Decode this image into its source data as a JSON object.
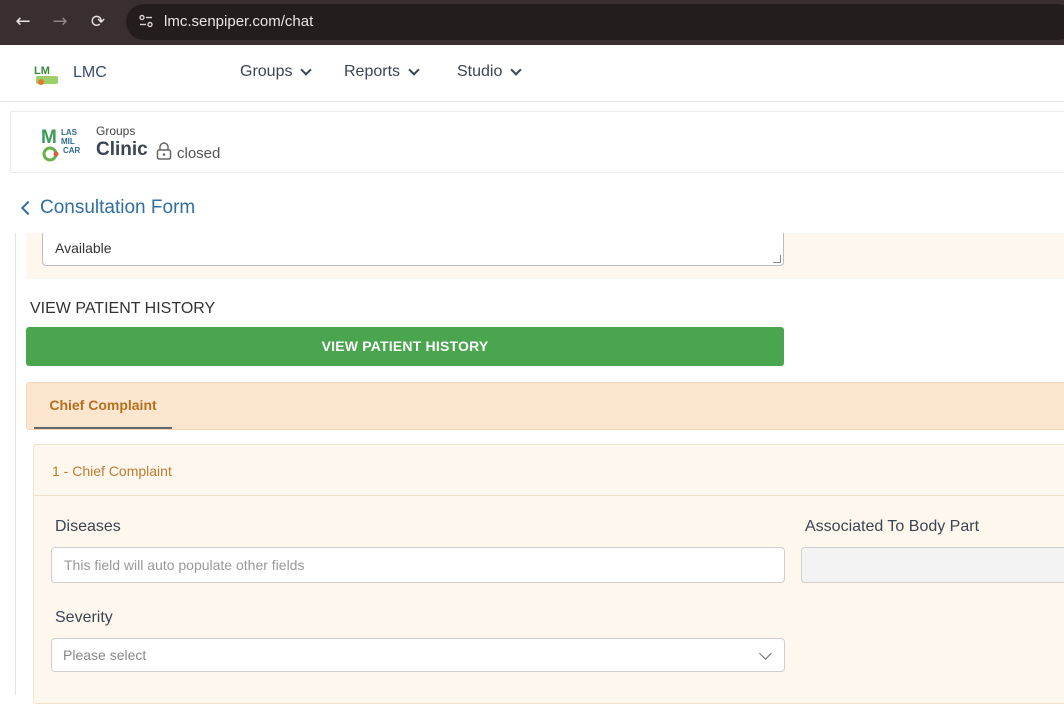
{
  "browser": {
    "url": "lmc.senpiper.com/chat",
    "back_icon": "arrow-left-icon",
    "forward_icon": "arrow-right-icon",
    "reload_icon": "reload-icon",
    "site_info_icon": "tune-icon"
  },
  "app": {
    "name": "LMC",
    "nav": [
      {
        "label": "Groups"
      },
      {
        "label": "Reports"
      },
      {
        "label": "Studio"
      }
    ]
  },
  "group": {
    "label": "Groups",
    "name": "Clinic",
    "status": "closed"
  },
  "form": {
    "back_label": "Consultation Form",
    "available_value": "Available",
    "view_history_heading": "VIEW PATIENT HISTORY",
    "view_history_button": "VIEW PATIENT HISTORY",
    "tabs": [
      {
        "label": "Chief Complaint"
      }
    ],
    "section": {
      "title": "1 - Chief Complaint",
      "fields": {
        "diseases_label": "Diseases",
        "diseases_placeholder": "This field will auto populate other fields",
        "body_part_label": "Associated To Body Part",
        "body_part_value": "",
        "severity_label": "Severity",
        "severity_placeholder": "Please select"
      }
    }
  },
  "colors": {
    "browser_bar": "#3a2f30",
    "link_blue": "#2f6fa3",
    "button_green": "#4aa64e",
    "tab_band": "#fde6cf",
    "accent_orange": "#b5701e"
  }
}
